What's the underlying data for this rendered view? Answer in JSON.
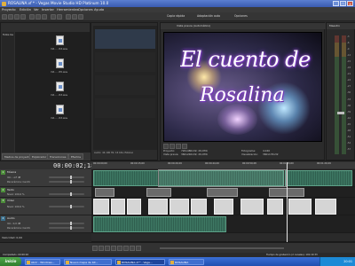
{
  "window": {
    "title": "ROSALINA.vf * - Vegas Movie Studio HD Platinum 10.0",
    "controls": [
      "_",
      "□",
      "×"
    ]
  },
  "menu": [
    "Proyecto",
    "Edición",
    "Ver",
    "Insertar",
    "Herramientas",
    "Opciones",
    "Ayuda"
  ],
  "toolbar": {
    "icons": [
      "new-icon",
      "open-icon",
      "save-icon",
      "properties-icon",
      "cut-icon",
      "copy-icon",
      "paste-icon",
      "undo-icon",
      "redo-icon",
      "snap-icon",
      "cursor-icon",
      "zoom-icon"
    ],
    "preview_menu": [
      "Copia rápida",
      "Adaptación auto",
      "Opciones"
    ]
  },
  "left_panel": {
    "tree_root": "Todos los",
    "media": [
      {
        "label": "Vid... - R3.wav"
      },
      {
        "label": "Vid... - R5.wav"
      },
      {
        "label": "Vid... - R3.wav"
      },
      {
        "label": "Vid... - R3.wav"
      }
    ],
    "tabs": [
      "Medios de proyecto",
      "Explorador",
      "Transiciones",
      "Efectos"
    ]
  },
  "mid_column": {
    "info": "Audio: 44.100 Hz; 16 bits; Estéreo"
  },
  "preview": {
    "header": "Vista previa (Automático)",
    "title_line1": "El cuento de",
    "title_line2": "Rosalina",
    "info": {
      "project_label": "Proyecto:",
      "project_value": "720x480x32; 29,970i",
      "preview_label": "Vista previa:",
      "preview_value": "360x240x32; 29,970i",
      "frame_label": "Fotograma:",
      "frame_value": "4.040",
      "display_label": "Visualización:",
      "display_value": "360x176x32"
    }
  },
  "meter": {
    "header": "Maestro",
    "ticks": [
      "-3",
      "-6",
      "-9",
      "-12",
      "-15",
      "-18",
      "-21",
      "-24",
      "-27",
      "-30",
      "-33",
      "-36",
      "-39",
      "-42",
      "-45",
      "-48",
      "-51",
      "-54",
      "-57"
    ]
  },
  "timeline": {
    "timecode": "00:00:02;18",
    "ruler": [
      "00:00:00;00",
      "00:00:15;00",
      "00:00:29;29",
      "00:00:44;29",
      "00:00:59;28",
      "00:01:15;00",
      "00:01:29;29"
    ],
    "tracks": [
      {
        "num": "1",
        "name": "Música",
        "level": "Vol.: -inf dB",
        "pan": "Panorámica: Centro"
      },
      {
        "num": "2",
        "name": "Texto",
        "level": "Nivel: 100,0 %",
        "pan": ""
      },
      {
        "num": "3",
        "name": "Vídeo",
        "level": "Nivel: 100,0 %",
        "pan": ""
      },
      {
        "num": "4",
        "name": "Audio",
        "level": "Vol.: 0,0 dB",
        "pan": "Panorámica: Centro"
      }
    ],
    "velocity": "Velocidad: 0,00"
  },
  "status": {
    "left": "Completado: 00:00:02",
    "right": "Tiempo de grabación (2 canales): 191:19:33"
  },
  "taskbar": {
    "start": "inicio",
    "tasks": [
      {
        "label": "Abrir - Windows..."
      },
      {
        "label": "Nuevo mapa de bit..."
      },
      {
        "label": "ROSALINA.vf * - Vega...",
        "active": true
      },
      {
        "label": "ROSALINA"
      }
    ],
    "clock": "20:01"
  },
  "colors": {
    "accent_blue": "#3a5bb0",
    "audio_clip": "#3f7a65",
    "start_green": "#2f7e2c"
  }
}
